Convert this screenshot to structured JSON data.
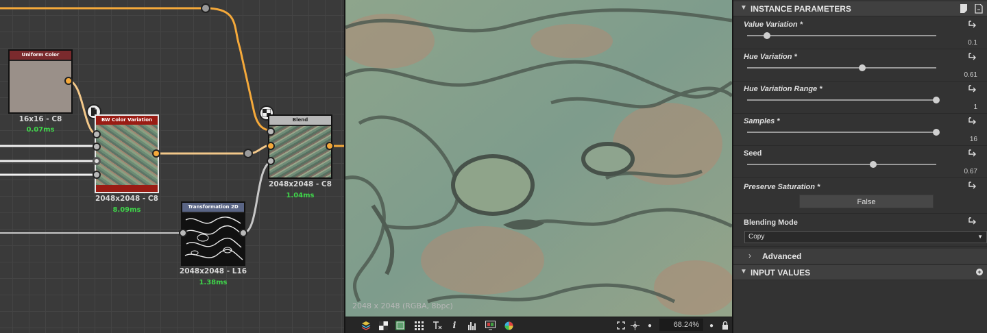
{
  "graph": {
    "nodes": {
      "uniform": {
        "title": "Uniform Color",
        "info": "16x16 - C8",
        "time": "0.07ms",
        "header_color": "#7a2a2d",
        "body_color": "#9a9089"
      },
      "bwcolor": {
        "title": "BW Color Variation",
        "info": "2048x2048 - C8",
        "time": "8.09ms",
        "header_color": "#9a1c14"
      },
      "blend": {
        "title": "Blend",
        "info": "2048x2048 - C8",
        "time": "1.04ms",
        "header_color": "#b8b8b8"
      },
      "transform": {
        "title": "Transformation 2D",
        "info": "2048x2048 - L16",
        "time": "1.38ms",
        "header_color": "#5a6585"
      }
    },
    "wire_colors": {
      "color": "#f5a93a",
      "grey": "#c8c8c8",
      "white": "#f2f2f2"
    }
  },
  "viewport": {
    "resolution_label": "2048 x 2048 (RGBA, 8bpc)",
    "zoom": "68.24%",
    "toolbar_icons": [
      "layers-icon",
      "checker-icon",
      "color-channel-icon",
      "tile-grid-icon",
      "text-transform-icon",
      "info-icon",
      "histogram-icon",
      "display-icon",
      "color-wheel-icon"
    ]
  },
  "properties": {
    "instance_header": "INSTANCE PARAMETERS",
    "params": [
      {
        "label": "Value Variation *",
        "value": "0.1",
        "fraction": 0.105
      },
      {
        "label": "Hue Variation *",
        "value": "0.61",
        "fraction": 0.607
      },
      {
        "label": "Hue Variation Range *",
        "value": "1",
        "fraction": 1.0
      },
      {
        "label": "Samples *",
        "value": "16",
        "fraction": 1.0
      },
      {
        "label": "Seed",
        "value": "0.67",
        "fraction": 0.665
      }
    ],
    "preserve_saturation": {
      "label": "Preserve Saturation *",
      "value": "False"
    },
    "blending_mode": {
      "label": "Blending Mode",
      "value": "Copy"
    },
    "advanced_label": "Advanced",
    "input_values_header": "INPUT VALUES"
  }
}
